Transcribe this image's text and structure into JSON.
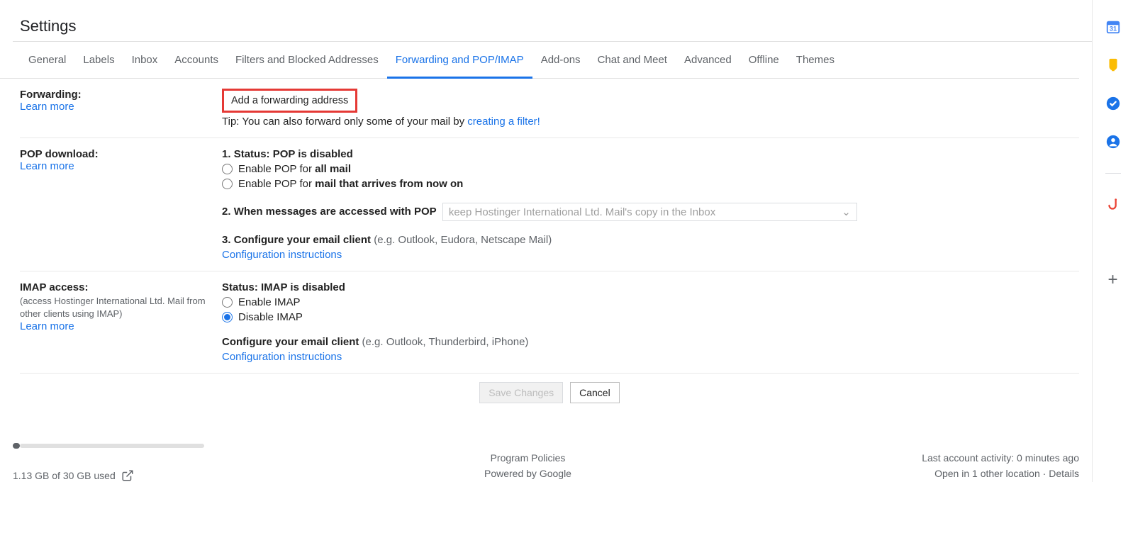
{
  "page_title": "Settings",
  "tabs": [
    "General",
    "Labels",
    "Inbox",
    "Accounts",
    "Filters and Blocked Addresses",
    "Forwarding and POP/IMAP",
    "Add-ons",
    "Chat and Meet",
    "Advanced",
    "Offline",
    "Themes"
  ],
  "active_tab_index": 5,
  "forwarding": {
    "label": "Forwarding:",
    "learn_more": "Learn more",
    "add_button": "Add a forwarding address",
    "tip_prefix": "Tip: You can also forward only some of your mail by ",
    "tip_link": "creating a filter!"
  },
  "pop": {
    "label": "POP download:",
    "learn_more": "Learn more",
    "status_num": "1. ",
    "status_prefix": "Status: ",
    "status_value": "POP is disabled",
    "opt1_prefix": "Enable POP for ",
    "opt1_bold": "all mail",
    "opt2_prefix": "Enable POP for ",
    "opt2_bold": "mail that arrives from now on",
    "step2_num": "2. ",
    "step2_label": "When messages are accessed with POP",
    "select_value": "keep Hostinger International Ltd. Mail's copy in the Inbox",
    "step3_num": "3. ",
    "step3_label": "Configure your email client ",
    "step3_hint": "(e.g. Outlook, Eudora, Netscape Mail)",
    "config_link": "Configuration instructions"
  },
  "imap": {
    "label": "IMAP access:",
    "sub": "(access Hostinger International Ltd. Mail from other clients using IMAP)",
    "learn_more": "Learn more",
    "status_prefix": "Status: ",
    "status_value": "IMAP is disabled",
    "opt_enable": "Enable IMAP",
    "opt_disable": "Disable IMAP",
    "conf_label": "Configure your email client ",
    "conf_hint": "(e.g. Outlook, Thunderbird, iPhone)",
    "config_link": "Configuration instructions"
  },
  "actions": {
    "save": "Save Changes",
    "cancel": "Cancel"
  },
  "footer": {
    "storage": "1.13 GB of 30 GB used",
    "policies": "Program Policies",
    "powered": "Powered by Google",
    "activity": "Last account activity: 0 minutes ago",
    "open_in": "Open in 1 other location · ",
    "details": "Details"
  },
  "side_icons": [
    "calendar-icon",
    "keep-icon",
    "tasks-icon",
    "contacts-icon",
    "phishing-icon"
  ]
}
